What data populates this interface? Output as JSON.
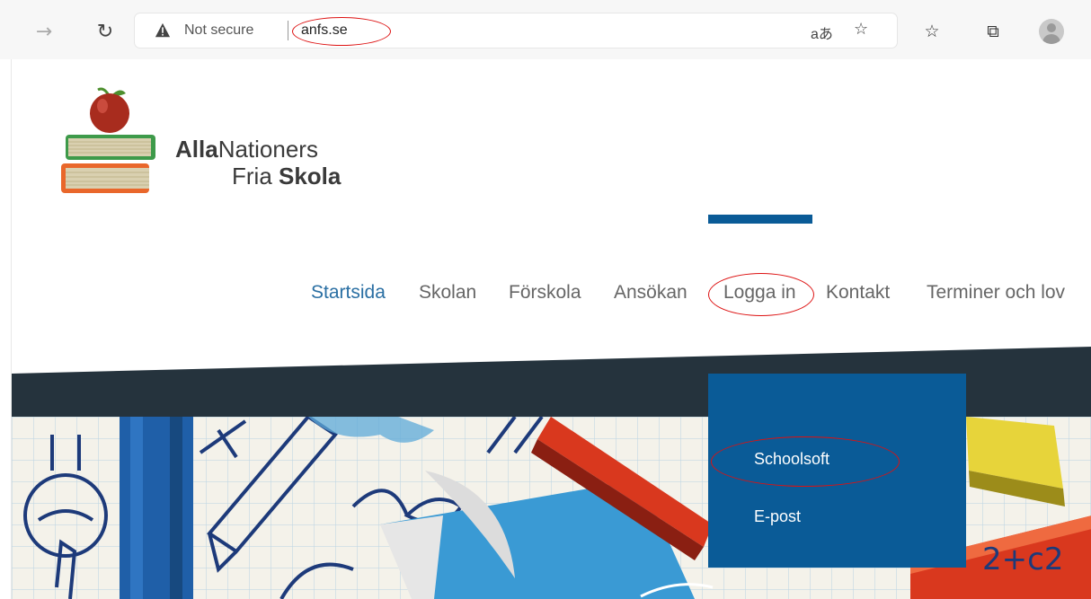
{
  "browser": {
    "security_text": "Not secure",
    "url": "anfs.se",
    "read_aloud_label": "aあ",
    "icons": {
      "back": "back-arrow-icon",
      "reload": "reload-icon",
      "warning": "warning-icon",
      "add_favorite": "add-favorite-icon",
      "favorites": "favorites-icon",
      "collections": "collections-icon",
      "profile": "profile-icon"
    }
  },
  "site": {
    "name_line1_bold": "Alla",
    "name_line1_rest": "Nationers",
    "name_line2_rest": "Fria ",
    "name_line2_bold": "Skola",
    "nav": [
      {
        "label": "Startsida",
        "active": true
      },
      {
        "label": "Skolan"
      },
      {
        "label": "Förskola"
      },
      {
        "label": "Ansökan"
      },
      {
        "label": "Logga in"
      },
      {
        "label": "Kontakt"
      },
      {
        "label": "Terminer och lov"
      }
    ],
    "dropdown": [
      {
        "label": "Schoolsoft"
      },
      {
        "label": "E-post"
      }
    ],
    "hero_formula_fragment": "2+c2",
    "colors": {
      "accent": "#0a5b97",
      "dark_band": "#25333d",
      "nav_active": "#2a6fa3",
      "nav_text": "#666666",
      "annotation": "#dd1111"
    }
  }
}
